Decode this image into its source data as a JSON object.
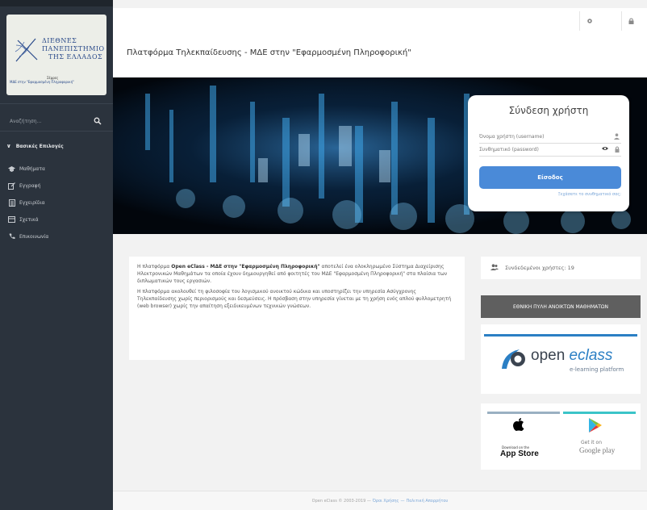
{
  "sidebar": {
    "logo": {
      "line1": "ΔΙΕΘΝΕΣ",
      "line2": "ΠΑΝΕΠΙΣΤΗΜΙΟ",
      "line3": "ΤΗΣ ΕΛΛΑΔΟΣ",
      "sub1": "Σέρρες",
      "sub2": "ΜΔΕ στην \"Εφαρμοσμένη Πληροφορική\""
    },
    "search_placeholder": "Αναζήτηση...",
    "group_label": "Βασικές Επιλογές",
    "items": [
      {
        "label": "Μαθήματα",
        "icon": "graduation-cap-icon"
      },
      {
        "label": "Εγγραφή",
        "icon": "edit-icon"
      },
      {
        "label": "Εγχειρίδια",
        "icon": "document-icon"
      },
      {
        "label": "Σχετικά",
        "icon": "card-icon"
      },
      {
        "label": "Επικοινωνία",
        "icon": "phone-icon"
      }
    ]
  },
  "header": {
    "title": "Πλατφόρμα Τηλεκπαίδευσης - ΜΔΕ στην \"Εφαρμοσμένη Πληροφορική\""
  },
  "login": {
    "title": "Σύνδεση χρήστη",
    "username_placeholder": "Όνομα χρήστη (username)",
    "password_placeholder": "Συνθηματικό (password)",
    "submit_label": "Είσοδος",
    "forgot_label": "Ξεχάσατε το συνθηματικό σας;"
  },
  "info": {
    "p1_pre": "Η πλατφόρμα ",
    "p1_bold": "Open eClass - ΜΔΕ στην \"Εφαρμοσμένη Πληροφορική\"",
    "p1_post": " αποτελεί ένα ολοκληρωμένο Σύστημα Διαχείρισης Ηλεκτρονικών Μαθημάτων τα οποία έχουν δημιουργηθεί από φοιτητές του ΜΔΕ \"Εφαρμοσμένη Πληροφορική\" στα πλαίσια των διπλωματικών τους εργασιών.",
    "p2": "Η πλατφόρμα ακολουθεί τη φιλοσοφία του λογισμικού ανοικτού κώδικα και υποστηρίζει την υπηρεσία Ασύγχρονης Τηλεκπαίδευσης χωρίς περιορισμούς και δεσμεύσεις. Η πρόσβαση στην υπηρεσία γίνεται με τη χρήση ενός απλού φυλλομετρητή (web browser) χωρίς την απαίτηση εξειδικευμένων τεχνικών γνώσεων."
  },
  "online_users": "Συνδεδεμένοι χρήστες: 19",
  "external_link": "ΕΘΝΙΚΗ ΠΥΛΗ ΑΝΟΙΚΤΩΝ ΜΑΘΗΜΑΤΩΝ",
  "eclass_brand": {
    "word1": "open ",
    "word2": "eclass",
    "tagline": "e-learning platform"
  },
  "apps": {
    "appstore_small": "Download on the",
    "appstore_big": "App Store",
    "googleplay_small": "Get it on",
    "googleplay_big": "Google play"
  },
  "footer": {
    "copyright": "Open eClass © 2003-2019 —",
    "terms": "Όροι Χρήσης",
    "sep": "—",
    "privacy": "Πολιτική Απορρήτου"
  },
  "colors": {
    "sidebar_bg": "#2b333d",
    "accent_blue": "#4a8ad8",
    "external_btn": "#5f5f5f"
  }
}
